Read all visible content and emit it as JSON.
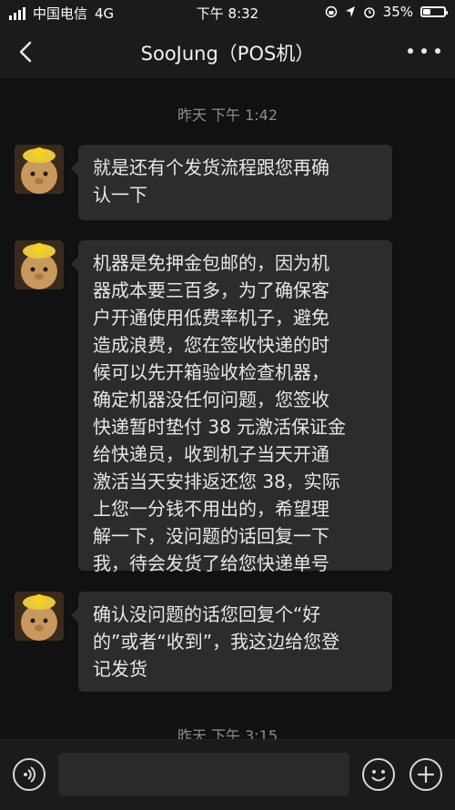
{
  "status_bar": {
    "carrier": "中国电信",
    "network": "4G",
    "time": "下午 8:32",
    "battery_percent_label": "35%",
    "battery_level": 0.35
  },
  "nav": {
    "title": "SooJung（POS机）"
  },
  "chat": {
    "timestamps": [
      "昨天 下午 1:42",
      "昨天 下午 3:15"
    ],
    "messages": [
      "就是还有个发货流程跟您再确\n认一下",
      "机器是免押金包邮的，因为机\n器成本要三百多，为了确保客\n户开通使用低费率机子，避免\n造成浪费，您在签收快递的时\n候可以先开箱验收检查机器，\n确定机器没任何问题，您签收\n快递暂时垫付 38 元激活保证金\n给快递员，收到机子当天开通\n激活当天安排返还您 38，实际\n上您一分钱不用出的，希望理\n解一下，没问题的话回复一下\n我，待会发货了给您快递单号",
      "确认没问题的话您回复个“好\n的”或者“收到”，我这边给您登\n记发货"
    ]
  },
  "icons": {
    "back": "chevron-left-icon",
    "more": "more-dots-icon",
    "voice": "voice-icon",
    "emoji": "emoji-icon",
    "plus": "plus-icon"
  },
  "colors": {
    "background": "#111111",
    "bubble": "#2c2c2c",
    "bar": "#1b1b1b",
    "timestamp": "#8d8d8d"
  }
}
